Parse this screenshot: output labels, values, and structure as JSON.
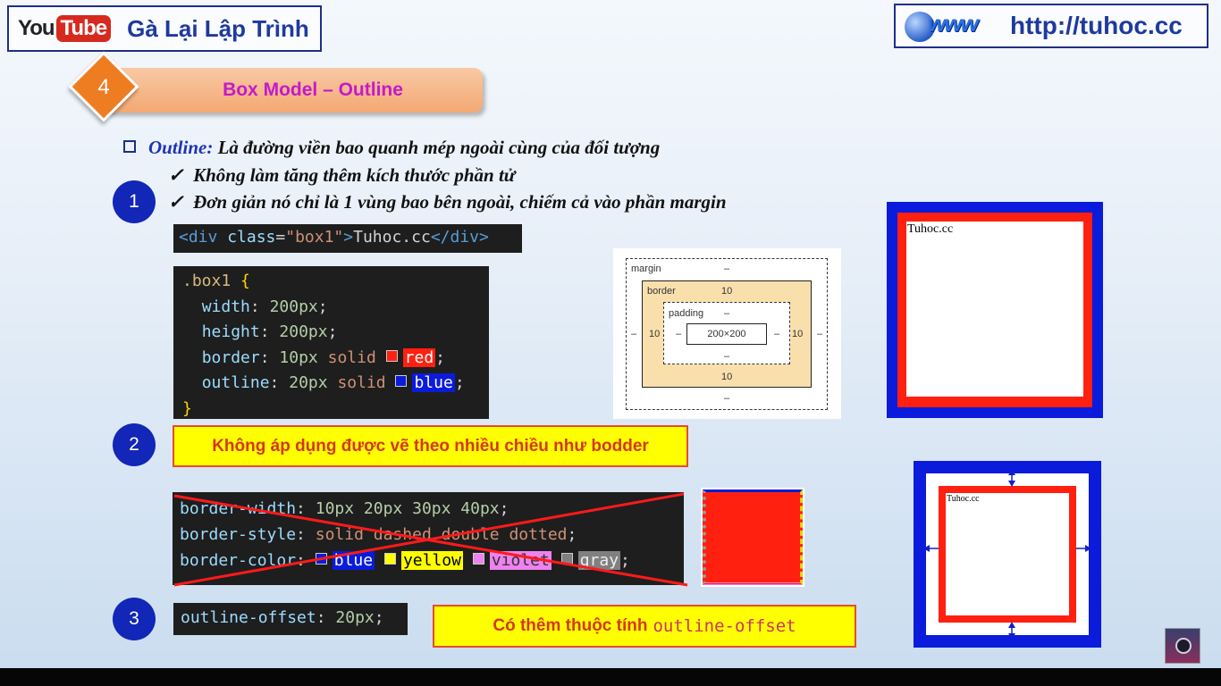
{
  "header": {
    "youtube_logo": {
      "you": "You",
      "tube": "Tube"
    },
    "channel_name": "Gà Lại Lập Trình",
    "www_logo": "www",
    "site_url": "http://tuhoc.cc"
  },
  "section": {
    "number": "4",
    "title": "Box Model – Outline"
  },
  "intro": {
    "term": "Outline:",
    "definition": "Là đường viền bao quanh mép ngoài cùng của đối tượng",
    "checks": [
      "Không làm tăng thêm kích thước phần tử",
      "Đơn giản nó chỉ là 1 vùng bao bên ngoài, chiếm cả vào phần margin"
    ],
    "check_mark": "✓"
  },
  "steps": [
    "1",
    "2",
    "3"
  ],
  "html_snippet": {
    "open_tag": "<div",
    "attr": "class",
    "eq": "=",
    "value": "\"box1\"",
    "close_bracket": ">",
    "text": "Tuhoc.cc",
    "end_tag": "</div>"
  },
  "css_snippet": {
    "selector": ".box1",
    "open_brace": "{",
    "close_brace": "}",
    "lines": [
      {
        "prop": "width",
        "value": "200px",
        "semicolon": ";"
      },
      {
        "prop": "height",
        "value": "200px",
        "semicolon": ";"
      },
      {
        "prop": "border",
        "num": "10px",
        "kw": "solid",
        "color_name": "red",
        "semicolon": ";"
      },
      {
        "prop": "outline",
        "num": "20px",
        "kw": "solid",
        "color_name": "blue",
        "semicolon": ";"
      }
    ],
    "colon": ":"
  },
  "box_model": {
    "margin_label": "margin",
    "border_label": "border",
    "padding_label": "padding",
    "content_size": "200×200",
    "margin_value": "–",
    "border_value": "10",
    "padding_value": "–"
  },
  "preview1": {
    "text": "Tuhoc.cc"
  },
  "callout2": "Không áp dụng được vẽ theo nhiều chiều như bodder",
  "crossed_code": {
    "line1": {
      "prop": "border-width",
      "values": "10px 20px 30px 40px",
      "semicolon": ";"
    },
    "line2": {
      "prop": "border-style",
      "values": "solid dashed double dotted",
      "semicolon": ";"
    },
    "line3": {
      "prop": "border-color",
      "colors": [
        "blue",
        "yellow",
        "violet",
        "gray"
      ],
      "semicolon": ";"
    }
  },
  "code3": {
    "prop": "outline-offset",
    "value": "20px",
    "semicolon": ";"
  },
  "callout3": {
    "text": "Có thêm thuộc tính",
    "code": "outline-offset"
  },
  "preview2": {
    "text": "Tuhoc.cc"
  },
  "colors": {
    "outline_blue": "#0a1bdc",
    "border_red": "#ff2010",
    "callout_yellow": "#ffff00",
    "step_circle": "#1226b8",
    "title_magenta": "#c41acb"
  }
}
